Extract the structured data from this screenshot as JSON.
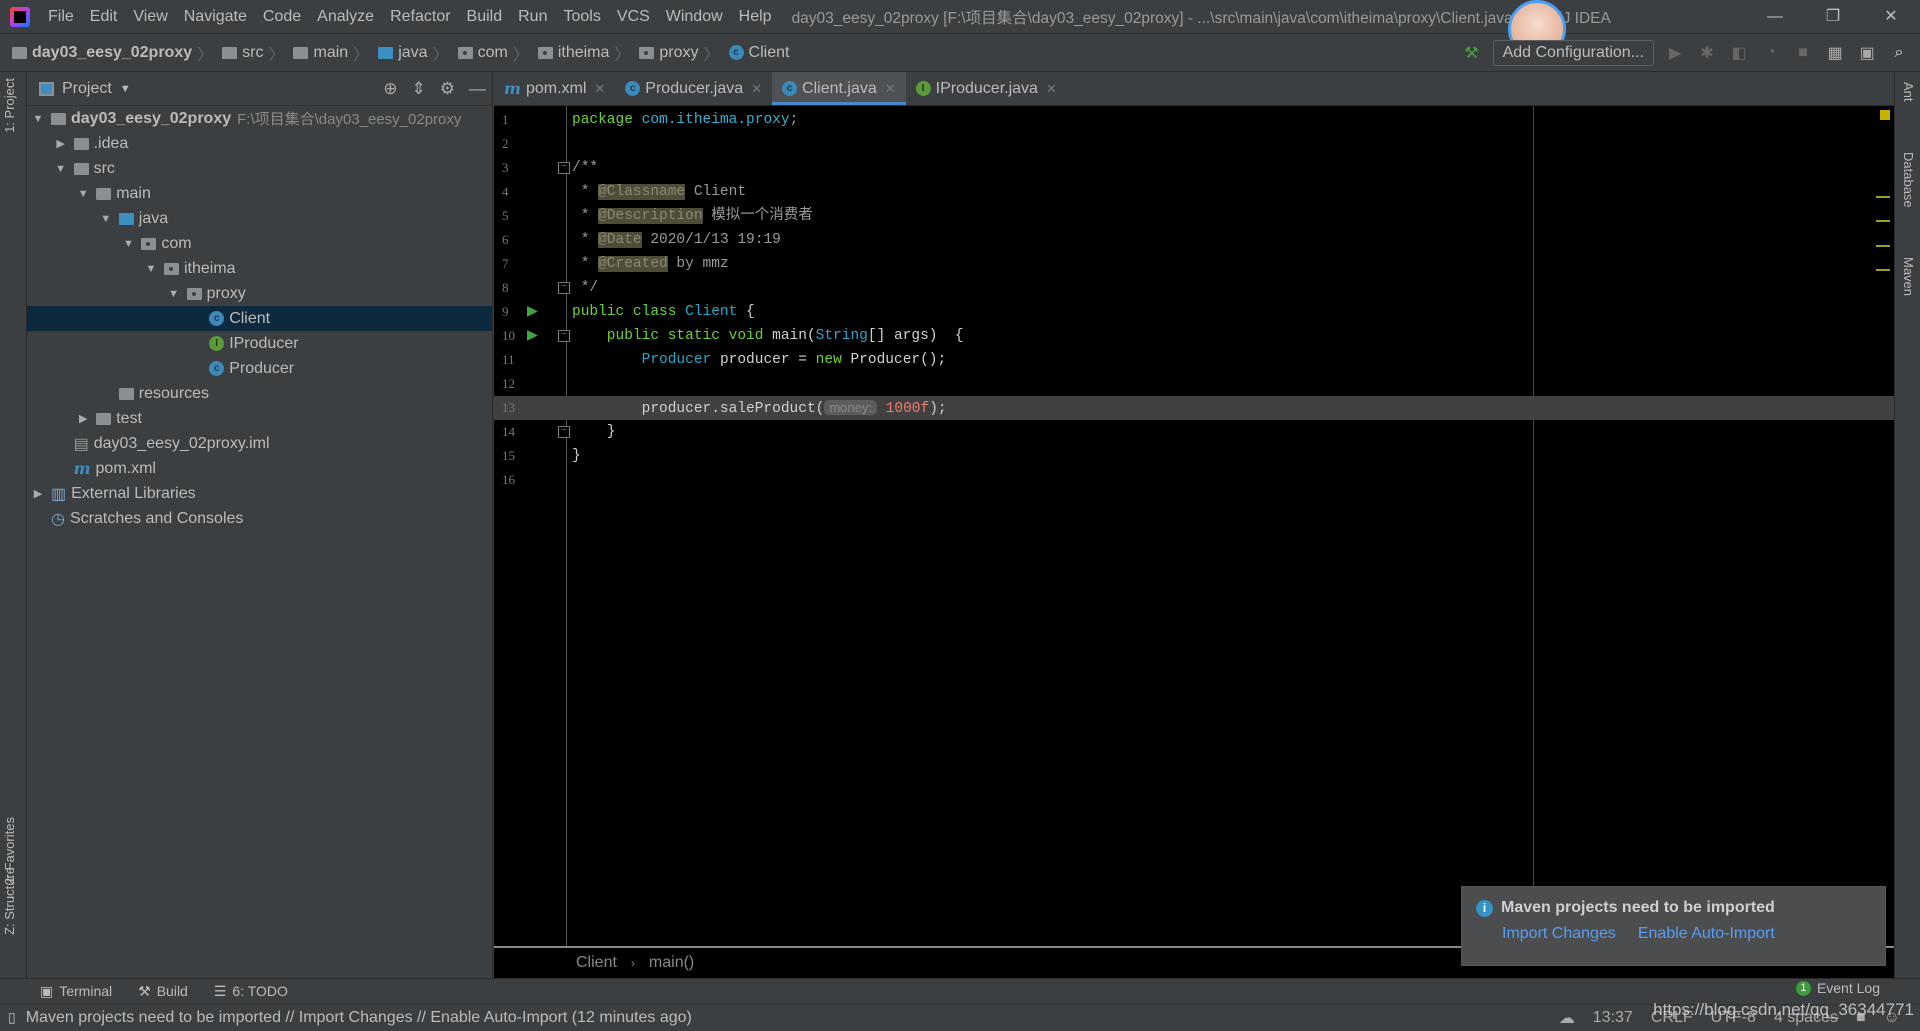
{
  "menu": [
    "File",
    "Edit",
    "View",
    "Navigate",
    "Code",
    "Analyze",
    "Refactor",
    "Build",
    "Run",
    "Tools",
    "VCS",
    "Window",
    "Help"
  ],
  "window_title": "day03_eesy_02proxy [F:\\项目集合\\day03_eesy_02proxy] - ...\\src\\main\\java\\com\\itheima\\proxy\\Client.java - IntelliJ IDEA",
  "breadcrumb": [
    {
      "label": "day03_eesy_02proxy",
      "icon": "module-icon"
    },
    {
      "label": "src",
      "icon": "folder-icon"
    },
    {
      "label": "main",
      "icon": "folder-icon"
    },
    {
      "label": "java",
      "icon": "source-folder-icon"
    },
    {
      "label": "com",
      "icon": "package-icon"
    },
    {
      "label": "itheima",
      "icon": "package-icon"
    },
    {
      "label": "proxy",
      "icon": "package-icon"
    },
    {
      "label": "Client",
      "icon": "class-icon"
    }
  ],
  "toolbar": {
    "add_configuration": "Add Configuration..."
  },
  "project_panel": {
    "title": "Project",
    "tree": [
      {
        "label": "day03_eesy_02proxy",
        "path": "F:\\项目集合\\day03_eesy_02proxy",
        "depth": 0,
        "arrow": "expanded",
        "icon": "module",
        "bold": true
      },
      {
        "label": ".idea",
        "depth": 1,
        "arrow": "collapsed",
        "icon": "folder"
      },
      {
        "label": "src",
        "depth": 1,
        "arrow": "expanded",
        "icon": "folder"
      },
      {
        "label": "main",
        "depth": 2,
        "arrow": "expanded",
        "icon": "folder"
      },
      {
        "label": "java",
        "depth": 3,
        "arrow": "expanded",
        "icon": "source"
      },
      {
        "label": "com",
        "depth": 4,
        "arrow": "expanded",
        "icon": "package"
      },
      {
        "label": "itheima",
        "depth": 5,
        "arrow": "expanded",
        "icon": "package"
      },
      {
        "label": "proxy",
        "depth": 6,
        "arrow": "expanded",
        "icon": "package"
      },
      {
        "label": "Client",
        "depth": 7,
        "arrow": "none",
        "icon": "class",
        "selected": true
      },
      {
        "label": "IProducer",
        "depth": 7,
        "arrow": "none",
        "icon": "interface"
      },
      {
        "label": "Producer",
        "depth": 7,
        "arrow": "none",
        "icon": "class"
      },
      {
        "label": "resources",
        "depth": 3,
        "arrow": "none",
        "icon": "folder"
      },
      {
        "label": "test",
        "depth": 2,
        "arrow": "collapsed",
        "icon": "folder"
      },
      {
        "label": "day03_eesy_02proxy.iml",
        "depth": 1,
        "arrow": "none",
        "icon": "iml"
      },
      {
        "label": "pom.xml",
        "depth": 1,
        "arrow": "none",
        "icon": "maven"
      },
      {
        "label": "External Libraries",
        "depth": 0,
        "arrow": "collapsed",
        "icon": "library"
      },
      {
        "label": "Scratches and Consoles",
        "depth": 0,
        "arrow": "none",
        "icon": "scratch"
      }
    ]
  },
  "left_stripe": {
    "project": "1: Project",
    "favorites": "2: Favorites",
    "structure": "Z: Structure"
  },
  "right_stripe": {
    "ant": "Ant",
    "database": "Database",
    "maven": "Maven"
  },
  "tabs": [
    {
      "label": "pom.xml",
      "icon": "maven"
    },
    {
      "label": "Producer.java",
      "icon": "class"
    },
    {
      "label": "Client.java",
      "icon": "class",
      "active": true
    },
    {
      "label": "IProducer.java",
      "icon": "interface"
    }
  ],
  "code": [
    [
      {
        "t": "package ",
        "k": "kw"
      },
      {
        "t": "com.itheima.proxy",
        "k": "pkg"
      },
      {
        "t": ";",
        "k": "cm"
      }
    ],
    [],
    [
      {
        "t": "/**",
        "k": "cm"
      }
    ],
    [
      {
        "t": " * ",
        "k": "cm"
      },
      {
        "t": "@Classname",
        "k": "tag"
      },
      {
        "t": " Client",
        "k": "cm"
      }
    ],
    [
      {
        "t": " * ",
        "k": "cm"
      },
      {
        "t": "@Description",
        "k": "tag"
      },
      {
        "t": " 模拟一个消费者",
        "k": "cm"
      }
    ],
    [
      {
        "t": " * ",
        "k": "cm"
      },
      {
        "t": "@Date",
        "k": "tag"
      },
      {
        "t": " 2020/1/13 19:19",
        "k": "cm"
      }
    ],
    [
      {
        "t": " * ",
        "k": "cm"
      },
      {
        "t": "@Created",
        "k": "tag"
      },
      {
        "t": " by mmz",
        "k": "cm"
      }
    ],
    [
      {
        "t": " */",
        "k": "cm"
      }
    ],
    [
      {
        "t": "public class ",
        "k": "kw"
      },
      {
        "t": "Client",
        "k": "type"
      },
      {
        "t": " {",
        "k": ""
      }
    ],
    [
      {
        "t": "    public static void ",
        "k": "kw"
      },
      {
        "t": "main(",
        "k": ""
      },
      {
        "t": "String",
        "k": "type"
      },
      {
        "t": "[] args)  {",
        "k": ""
      }
    ],
    [
      {
        "t": "        "
      },
      {
        "t": "Producer",
        "k": "type"
      },
      {
        "t": " producer = ",
        "k": ""
      },
      {
        "t": "new ",
        "k": "kw"
      },
      {
        "t": "Producer();",
        "k": ""
      }
    ],
    [],
    [
      {
        "t": "        producer.saleProduct(",
        "k": ""
      },
      {
        "t": "money:",
        "k": "hint"
      },
      {
        "t": " 1000f",
        "k": "numv"
      },
      {
        "t": ");",
        "k": ""
      }
    ],
    [
      {
        "t": "    }",
        "k": ""
      }
    ],
    [
      {
        "t": "}",
        "k": ""
      }
    ],
    []
  ],
  "highlighted_line": 13,
  "run_markers": [
    9,
    10
  ],
  "fold_markers": [
    3,
    8,
    10,
    14
  ],
  "editor_breadcrumb": [
    "Client",
    "main()"
  ],
  "notification": {
    "title": "Maven projects need to be imported",
    "actions": [
      "Import Changes",
      "Enable Auto-Import"
    ]
  },
  "tool_windows": [
    {
      "label": "Terminal",
      "icon": "terminal-icon"
    },
    {
      "label": "Build",
      "icon": "hammer-icon"
    },
    {
      "label": "6: TODO",
      "icon": "list-icon"
    }
  ],
  "event_log": {
    "label": "Event Log",
    "count": "1"
  },
  "status": {
    "message": "Maven projects need to be imported // Import Changes // Enable Auto-Import (12 minutes ago)",
    "position": "13:37",
    "line_sep": "CRLF",
    "encoding": "UTF-8",
    "indent": "4 spaces"
  },
  "watermark": "https://blog.csdn.net/qq_36344771"
}
